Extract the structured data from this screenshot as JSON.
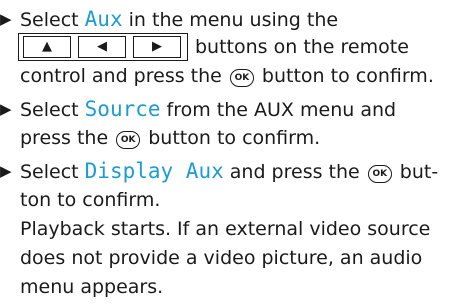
{
  "instructions": {
    "step1": {
      "bullet": "▶",
      "part1": "Select ",
      "highlight": "Aux",
      "part2": " in the menu using the",
      "keys": [
        "▲",
        "◀",
        "▶"
      ],
      "line2_rest": "buttons on the remote",
      "line3_pre": "control and press the ",
      "ok_label": "OK",
      "line3_post": " button to confirm."
    },
    "step2": {
      "bullet": "▶",
      "part1": "Select ",
      "highlight": "Source",
      "part2": " from the AUX menu and",
      "line2_pre": "press the ",
      "ok_label": "OK",
      "line2_post": " button to confirm."
    },
    "step3": {
      "bullet": "▶",
      "part1": "Select ",
      "highlight": "Display Aux",
      "part2": " and press the ",
      "ok_label": "OK",
      "part3": " but-",
      "line2": "ton to confirm.",
      "result_lines": [
        "Playback starts. If an external video source",
        "does not provide a video picture, an audio",
        "menu appears."
      ]
    }
  }
}
